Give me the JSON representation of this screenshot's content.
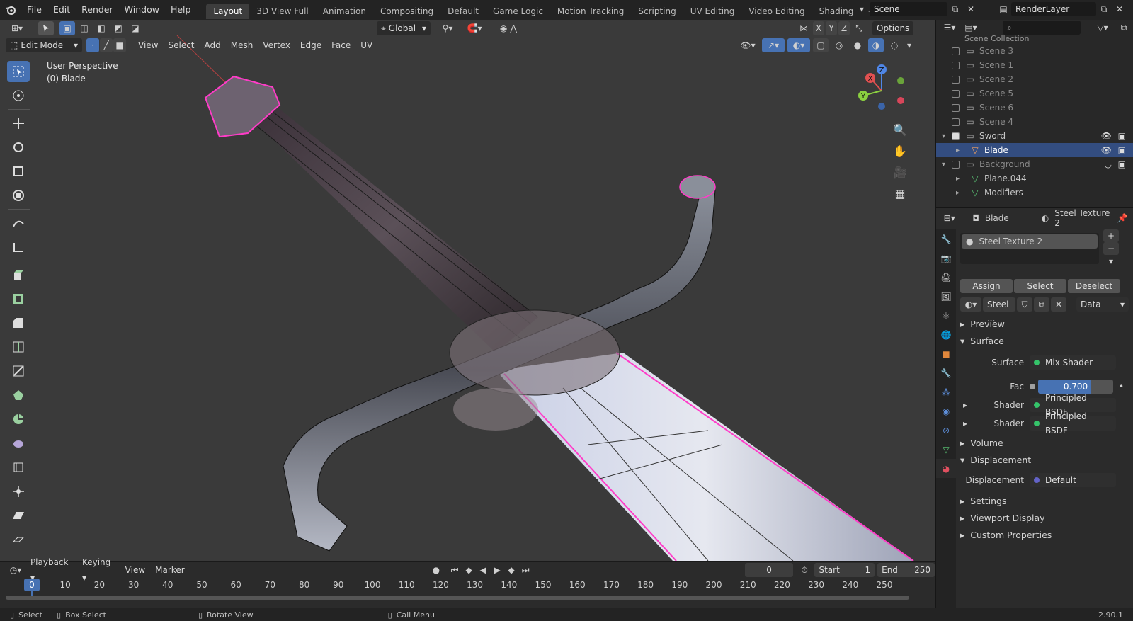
{
  "menu": [
    "File",
    "Edit",
    "Render",
    "Window",
    "Help"
  ],
  "workspaces": [
    "Layout",
    "3D View Full",
    "Animation",
    "Compositing",
    "Default",
    "Game Logic",
    "Motion Tracking",
    "Scripting",
    "UV Editing",
    "Video Editing",
    "Shading"
  ],
  "active_workspace": "Layout",
  "scene_field": "Scene",
  "layer_field": "RenderLayer",
  "viewport": {
    "orientation": "Global",
    "options": "Options",
    "axes": [
      "X",
      "Y",
      "Z"
    ],
    "mode": "Edit Mode",
    "menus": [
      "View",
      "Select",
      "Add",
      "Mesh",
      "Vertex",
      "Edge",
      "Face",
      "UV"
    ],
    "overlay_line1": "User Perspective",
    "overlay_line2": "(0) Blade",
    "gizmo_labels": [
      "Z",
      "Y",
      "X"
    ]
  },
  "timeline": {
    "menus": [
      "Playback",
      "Keying",
      "View",
      "Marker"
    ],
    "current_frame": "0",
    "start_label": "Start",
    "start": "1",
    "end_label": "End",
    "end": "250",
    "ticks": [
      "0",
      "10",
      "20",
      "30",
      "40",
      "50",
      "60",
      "70",
      "80",
      "90",
      "100",
      "110",
      "120",
      "130",
      "140",
      "150",
      "160",
      "170",
      "180",
      "190",
      "200",
      "210",
      "220",
      "230",
      "240",
      "250"
    ]
  },
  "status": {
    "select": "Select",
    "box_select": "Box Select",
    "rotate": "Rotate View",
    "call_menu": "Call Menu",
    "version": "2.90.1"
  },
  "outliner": {
    "header": "Scene Collection",
    "rows": [
      {
        "label": "Scene 3",
        "indent": 1,
        "dim": true
      },
      {
        "label": "Scene 1",
        "indent": 1,
        "dim": true
      },
      {
        "label": "Scene 2",
        "indent": 1,
        "dim": true
      },
      {
        "label": "Scene 5",
        "indent": 1,
        "dim": true
      },
      {
        "label": "Scene 6",
        "indent": 1,
        "dim": true
      },
      {
        "label": "Scene 4",
        "indent": 1,
        "dim": true
      },
      {
        "label": "Sword",
        "indent": 1,
        "dim": false
      },
      {
        "label": "Blade",
        "indent": 2,
        "dim": false,
        "selected": true
      },
      {
        "label": "Background",
        "indent": 1,
        "dim": true
      },
      {
        "label": "Plane.044",
        "indent": 2,
        "dim": false
      },
      {
        "label": "Modifiers",
        "indent": 2,
        "dim": false
      }
    ]
  },
  "properties": {
    "object": "Blade",
    "material": "Steel Texture 2",
    "slot": "Steel Texture 2",
    "assign": "Assign",
    "select": "Select",
    "deselect": "Deselect",
    "mat_field": "Steel ...",
    "link": "Data",
    "preview": "Preview",
    "surface_panel": "Surface",
    "surface_label": "Surface",
    "surface_value": "Mix Shader",
    "fac_label": "Fac",
    "fac_value": "0.700",
    "fac_fraction": 0.7,
    "shader_label": "Shader",
    "shader1": "Principled BSDF",
    "shader2": "Principled BSDF",
    "volume": "Volume",
    "displacement_panel": "Displacement",
    "displacement_label": "Displacement",
    "displacement_value": "Default",
    "settings": "Settings",
    "viewport_display": "Viewport Display",
    "custom_props": "Custom Properties"
  },
  "colors": {
    "accent": "#4772b3",
    "selection": "#334d80",
    "shader_socket": "#35c46a",
    "vector_socket": "#6363c7",
    "edge_highlight": "#ff3cc8"
  }
}
